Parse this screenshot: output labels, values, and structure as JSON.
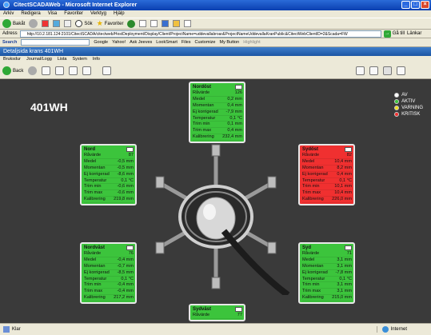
{
  "window": {
    "title": "CitectSCADAWeb - Microsoft Internet Explorer"
  },
  "ie_menu": [
    "Arkiv",
    "Redigera",
    "Visa",
    "Favoriter",
    "Verktyg",
    "Hjälp"
  ],
  "ie_toolbar": {
    "back": "Bakåt",
    "search": "Sök",
    "favorites": "Favoriter"
  },
  "address": {
    "label": "Adress",
    "url": "http://10.2.181.124:2101/CitectSCADA/citectweb/HostDeployment/Display/Client/ProjectName=uddevallabroar&ProjectNameUddevallaKranPublic&CitectWebClientID=2&Scada=FW",
    "go_label": "Gå till",
    "links_label": "Länkar"
  },
  "search_bar": {
    "label": "Search",
    "items": [
      "Google",
      "Yahoo!",
      "Ask Jeeves",
      "LookSmart",
      "Files",
      "Customize",
      "My Button",
      "Highlight"
    ]
  },
  "app": {
    "header": "Detaljsida krans 401WH",
    "menu": [
      "Bruksdur",
      "Journal/Logg",
      "Lista",
      "System",
      "Info"
    ],
    "back_label": "Back"
  },
  "crane": {
    "title": "401WH"
  },
  "legend": [
    {
      "label": "AV",
      "color": "#ffffff"
    },
    {
      "label": "AKTIV",
      "color": "#3cc43c"
    },
    {
      "label": "VARNING",
      "color": "#f0e020"
    },
    {
      "label": "KRITISK",
      "color": "#f03030"
    }
  ],
  "panels": {
    "nordost": {
      "name": "Nordöst",
      "state": "green",
      "rows": [
        {
          "label": "Råvärde",
          "value": "126"
        },
        {
          "label": "Medel",
          "value": "0,2 mm"
        },
        {
          "label": "Momentan",
          "value": "0,4 mm"
        },
        {
          "label": "Ej korrigerad",
          "value": "-7,9 mm"
        },
        {
          "label": "Temperatur",
          "value": "0,1 °C"
        },
        {
          "label": "Trim min",
          "value": "0,1 mm"
        },
        {
          "label": "Trim max",
          "value": "0,4 mm"
        },
        {
          "label": "Kalibrering",
          "value": "232,4 mm"
        }
      ]
    },
    "nord": {
      "name": "Nord",
      "state": "green",
      "rows": [
        {
          "label": "Råvärde",
          "value": "87"
        },
        {
          "label": "Medel",
          "value": "-0,5 mm"
        },
        {
          "label": "Momentan",
          "value": "-0,5 mm"
        },
        {
          "label": "Ej korrigerad",
          "value": "-8,6 mm"
        },
        {
          "label": "Temperatur",
          "value": "0,1 °C"
        },
        {
          "label": "Trim min",
          "value": "-0,6 mm"
        },
        {
          "label": "Trim max",
          "value": "-0,6 mm"
        },
        {
          "label": "Kalibrering",
          "value": "219,8 mm"
        }
      ]
    },
    "sydost": {
      "name": "Sydöst",
      "state": "red",
      "rows": [
        {
          "label": "Råvärde",
          "value": "82"
        },
        {
          "label": "Medel",
          "value": "10,4 mm"
        },
        {
          "label": "Momentan",
          "value": "8,2 mm"
        },
        {
          "label": "Ej korrigerad",
          "value": "0,4 mm"
        },
        {
          "label": "Temperatur",
          "value": "0,1 °C"
        },
        {
          "label": "Trim min",
          "value": "10,1 mm"
        },
        {
          "label": "Trim max",
          "value": "10,4 mm"
        },
        {
          "label": "Kalibrering",
          "value": "226,0 mm"
        }
      ]
    },
    "nordvast": {
      "name": "Nordväst",
      "state": "green",
      "rows": [
        {
          "label": "Råvärde",
          "value": "76"
        },
        {
          "label": "Medel",
          "value": "-0,4 mm"
        },
        {
          "label": "Momentan",
          "value": "-0,7 mm"
        },
        {
          "label": "Ej korrigerad",
          "value": "-8,5 mm"
        },
        {
          "label": "Temperatur",
          "value": "0,1 °C"
        },
        {
          "label": "Trim min",
          "value": "-0,4 mm"
        },
        {
          "label": "Trim max",
          "value": "-0,4 mm"
        },
        {
          "label": "Kalibrering",
          "value": "217,2 mm"
        }
      ]
    },
    "syd": {
      "name": "Syd",
      "state": "green",
      "rows": [
        {
          "label": "Råvärde",
          "value": "71"
        },
        {
          "label": "Medel",
          "value": "3,1 mm"
        },
        {
          "label": "Momentan",
          "value": "3,1 mm"
        },
        {
          "label": "Ej korrigerad",
          "value": "-7,8 mm"
        },
        {
          "label": "Temperatur",
          "value": "0,1 °C"
        },
        {
          "label": "Trim min",
          "value": "3,1 mm"
        },
        {
          "label": "Trim max",
          "value": "3,1 mm"
        },
        {
          "label": "Kalibrering",
          "value": "215,0 mm"
        }
      ]
    },
    "sydvast": {
      "name": "Sydväst",
      "state": "green",
      "rows": [
        {
          "label": "Råvärde",
          "value": "77"
        }
      ]
    }
  },
  "status": {
    "left": "Klar",
    "zone": "Internet"
  }
}
